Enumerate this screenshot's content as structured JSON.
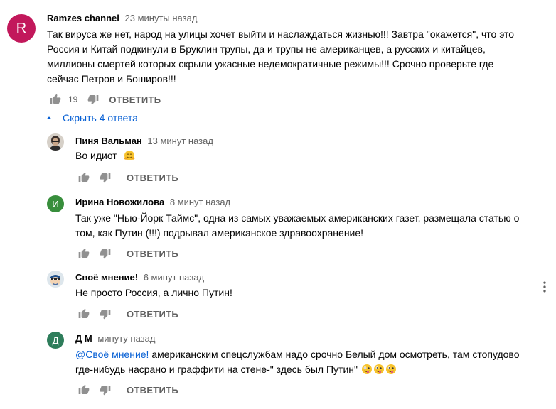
{
  "comments": [
    {
      "avatar_letter": "R",
      "avatar_color": "#c2185b",
      "author": "Ramzes channel",
      "time": "23 минуты назад",
      "lines": [
        "Так вируса же нет, народ на улицы хочет выйти и наслаждаться жизнью!!! Завтра \"окажется\", что это",
        "Россия и Китай подкинули в Бруклин трупы, да и трупы не американцев, а русских и китайцев,",
        "миллионы смертей которых скрыли ужасные недемократичные режимы!!! Срочно проверьте где",
        "сейчас Петров и Боширов!!!"
      ],
      "likes": "19",
      "reply_label": "ОТВЕТИТЬ"
    }
  ],
  "replies_toggle": {
    "label": "Скрыть 4 ответа",
    "icon": "chevron-up-icon"
  },
  "replies": [
    {
      "avatar": "photo",
      "author": "Пиня Вальман",
      "time": "13 минут назад",
      "text": "Во идиот",
      "emoji": "hugging-face",
      "reply_label": "ОТВЕТИТЬ"
    },
    {
      "avatar_letter": "И",
      "avatar_color": "#388e3c",
      "author": "Ирина Новожилова",
      "time": "8 минут назад",
      "lines": [
        "Так уже \"Нью-Йорк Таймс\", одна из самых уважаемых американских газет, размещала статью о",
        "том, как Путин (!!!) подрывал американское здравоохранение!"
      ],
      "reply_label": "ОТВЕТИТЬ"
    },
    {
      "avatar": "masked-face",
      "author": "Своё мнение!",
      "time": "6 минут назад",
      "text": "Не просто Россия, а лично Путин!",
      "reply_label": "ОТВЕТИТЬ"
    },
    {
      "avatar_letter": "Д",
      "avatar_color": "#2e7d5b",
      "author": "Д М",
      "time": "минуту назад",
      "mention": "@Своё мнение!",
      "line1_rest": " американским спецслужбам надо срочно Белый дом осмотреть, там стопудово",
      "line2": "где-нибудь насрано и граффити на стене-\" здесь был Путин\"",
      "reply_label": "ОТВЕТИТЬ"
    }
  ],
  "icons": {
    "like": "thumbs-up-icon",
    "dislike": "thumbs-down-icon",
    "menu": "more-vert-icon"
  },
  "colors": {
    "link": "#065fd4",
    "meta": "#606060",
    "text": "#030303"
  }
}
